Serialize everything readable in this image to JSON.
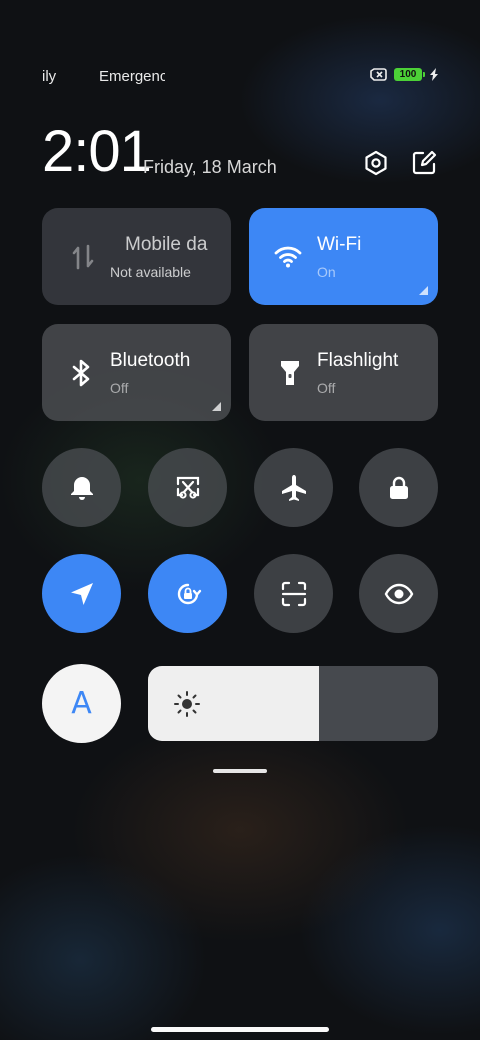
{
  "status_bar": {
    "carrier_left": "ily",
    "carrier_right": "Emergenc",
    "battery_level": "100",
    "icons": [
      "sim-error-icon",
      "battery-icon",
      "charging-bolt-icon"
    ]
  },
  "header": {
    "time": "2:01",
    "date": "Friday, 18 March",
    "icons": [
      "settings-icon",
      "edit-icon"
    ]
  },
  "tiles": [
    {
      "title": "Mobile da",
      "subtitle": "Not available",
      "icon": "mobile-data-icon",
      "active": false
    },
    {
      "title": "Wi-Fi",
      "subtitle": "On",
      "icon": "wifi-icon",
      "active": true
    },
    {
      "title": "Bluetooth",
      "subtitle": "Off",
      "icon": "bluetooth-icon",
      "active": false
    },
    {
      "title": "Flashlight",
      "subtitle": "Off",
      "icon": "flashlight-icon",
      "active": false
    }
  ],
  "toggles": [
    {
      "icon": "bell-icon",
      "active": false
    },
    {
      "icon": "screenshot-icon",
      "active": false
    },
    {
      "icon": "airplane-icon",
      "active": false
    },
    {
      "icon": "lock-icon",
      "active": false
    },
    {
      "icon": "location-icon",
      "active": true
    },
    {
      "icon": "rotation-lock-icon",
      "active": true
    },
    {
      "icon": "scan-icon",
      "active": false
    },
    {
      "icon": "eye-icon",
      "active": false
    }
  ],
  "auto_brightness": {
    "label": "A",
    "icon": "auto-brightness-icon"
  },
  "brightness": {
    "level_percent": 59,
    "icon": "sun-icon"
  },
  "colors": {
    "accent": "#3d87f5",
    "tile": "#505256",
    "battery": "#4cd137"
  }
}
